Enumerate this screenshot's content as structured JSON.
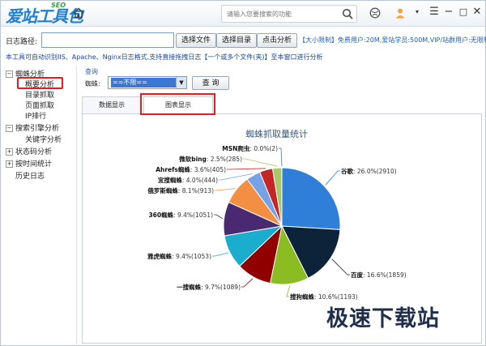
{
  "app": {
    "logo_text": "爱站工具包",
    "logo_seo": "SEO",
    "search_placeholder": "请输入您要搜索的功能"
  },
  "toolbar": {
    "log_path_label": "日志路径:",
    "log_path_value": "",
    "select_file": "选择文件",
    "select_dir": "选择目录",
    "click_analyze": "点击分析",
    "notice": "【大小限制】免费用户:20M,爱站学员:500M,VIP/站群用户:无限制",
    "info": "本工具可自动识别IIS、Apache、Nginx日志格式,支持直接拖拽日志【一个或多个文件(夹)】至本窗口进行分析"
  },
  "sidebar": {
    "items": [
      {
        "label": "蜘蛛分析",
        "level": 0,
        "expander": "-"
      },
      {
        "label": "概要分析",
        "level": 1,
        "selected": true
      },
      {
        "label": "目录抓取",
        "level": 1
      },
      {
        "label": "页面抓取",
        "level": 1
      },
      {
        "label": "IP排行",
        "level": 1
      },
      {
        "label": "搜索引擎分析",
        "level": 0,
        "expander": "-"
      },
      {
        "label": "关键字分析",
        "level": 1
      },
      {
        "label": "状态码分析",
        "level": 0,
        "expander": "+"
      },
      {
        "label": "按时间统计",
        "level": 0,
        "expander": "+"
      },
      {
        "label": "历史日志",
        "level": 0
      }
    ]
  },
  "query": {
    "title": "查询",
    "spider_label": "蜘蛛:",
    "spider_value": "==不限==",
    "query_button": "查 询"
  },
  "tabs": [
    {
      "label": "数据显示",
      "active": false
    },
    {
      "label": "图表显示",
      "active": true
    }
  ],
  "chart_data": {
    "type": "pie",
    "title": "蜘蛛抓取量统计",
    "slices": [
      {
        "name": "谷歌",
        "percent": 26.0,
        "value": 2910,
        "color": "#2f7ed8"
      },
      {
        "name": "百度",
        "percent": 16.6,
        "value": 1859,
        "color": "#0d233a"
      },
      {
        "name": "搜狗蜘蛛",
        "percent": 10.6,
        "value": 1193,
        "color": "#8bbc21"
      },
      {
        "name": "一搜蜘蛛",
        "percent": 9.7,
        "value": 1089,
        "color": "#910000"
      },
      {
        "name": "雅虎蜘蛛",
        "percent": 9.4,
        "value": 1053,
        "color": "#1aadce"
      },
      {
        "name": "360蜘蛛",
        "percent": 9.4,
        "value": 1051,
        "color": "#492970"
      },
      {
        "name": "俄罗斯蜘蛛",
        "percent": 8.1,
        "value": 913,
        "color": "#f28f43"
      },
      {
        "name": "宜搜蜘蛛",
        "percent": 4.0,
        "value": 444,
        "color": "#77a1e5"
      },
      {
        "name": "Ahrefs蜘蛛",
        "percent": 3.6,
        "value": 405,
        "color": "#c42525"
      },
      {
        "name": "微软bing",
        "percent": 2.5,
        "value": 285,
        "color": "#a6c96a"
      },
      {
        "name": "MSN爬虫",
        "percent": 0.0,
        "value": 2,
        "color": "#4572a7"
      }
    ]
  },
  "watermark": "极速下载站"
}
